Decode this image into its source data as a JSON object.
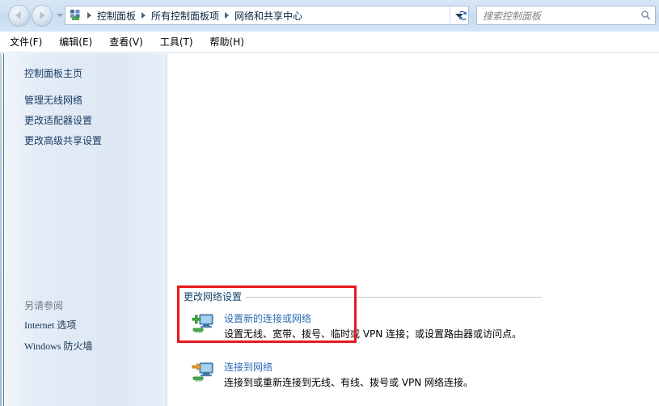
{
  "window": {
    "title": "网络和共享中心"
  },
  "topbar": {
    "back_tooltip": "后退",
    "forward_tooltip": "前进",
    "recent_tooltip": "最近浏览的位置",
    "breadcrumbs": [
      "控制面板",
      "所有控制面板项",
      "网络和共享中心"
    ],
    "address_dropdown": "▼",
    "refresh_label": "刷新",
    "search": {
      "placeholder": "搜索控制面板",
      "value": ""
    }
  },
  "menubar": {
    "items": [
      {
        "label": "文件(F)",
        "name": "menu-file"
      },
      {
        "label": "编辑(E)",
        "name": "menu-edit"
      },
      {
        "label": "查看(V)",
        "name": "menu-view"
      },
      {
        "label": "工具(T)",
        "name": "menu-tools"
      },
      {
        "label": "帮助(H)",
        "name": "menu-help"
      }
    ]
  },
  "sidebar": {
    "home_label": "控制面板主页",
    "tasks": [
      "管理无线网络",
      "更改适配器设置",
      "更改高级共享设置"
    ],
    "see_also": {
      "title": "另请参阅",
      "links": [
        "Internet 选项",
        "Windows 防火墙"
      ]
    }
  },
  "main": {
    "section_heading": "更改网络设置",
    "tasks": [
      {
        "title": "设置新的连接或网络",
        "description": "设置无线、宽带、拨号、临时或 VPN 连接；或设置路由器或访问点。",
        "icon": "new-connection-icon"
      },
      {
        "title": "连接到网络",
        "description": "连接到或重新连接到无线、有线、拨号或 VPN 网络连接。",
        "icon": "connect-network-icon"
      }
    ]
  },
  "annotation": {
    "highlight_color": "#e8191b",
    "highlight_target": "设置新的连接或网络"
  },
  "colors": {
    "link": "#2e6bb4",
    "sidebar_link": "#1b3c66",
    "heading": "#16466b",
    "chrome_top": "#cfe0f2",
    "highlight": "#e8191b"
  }
}
